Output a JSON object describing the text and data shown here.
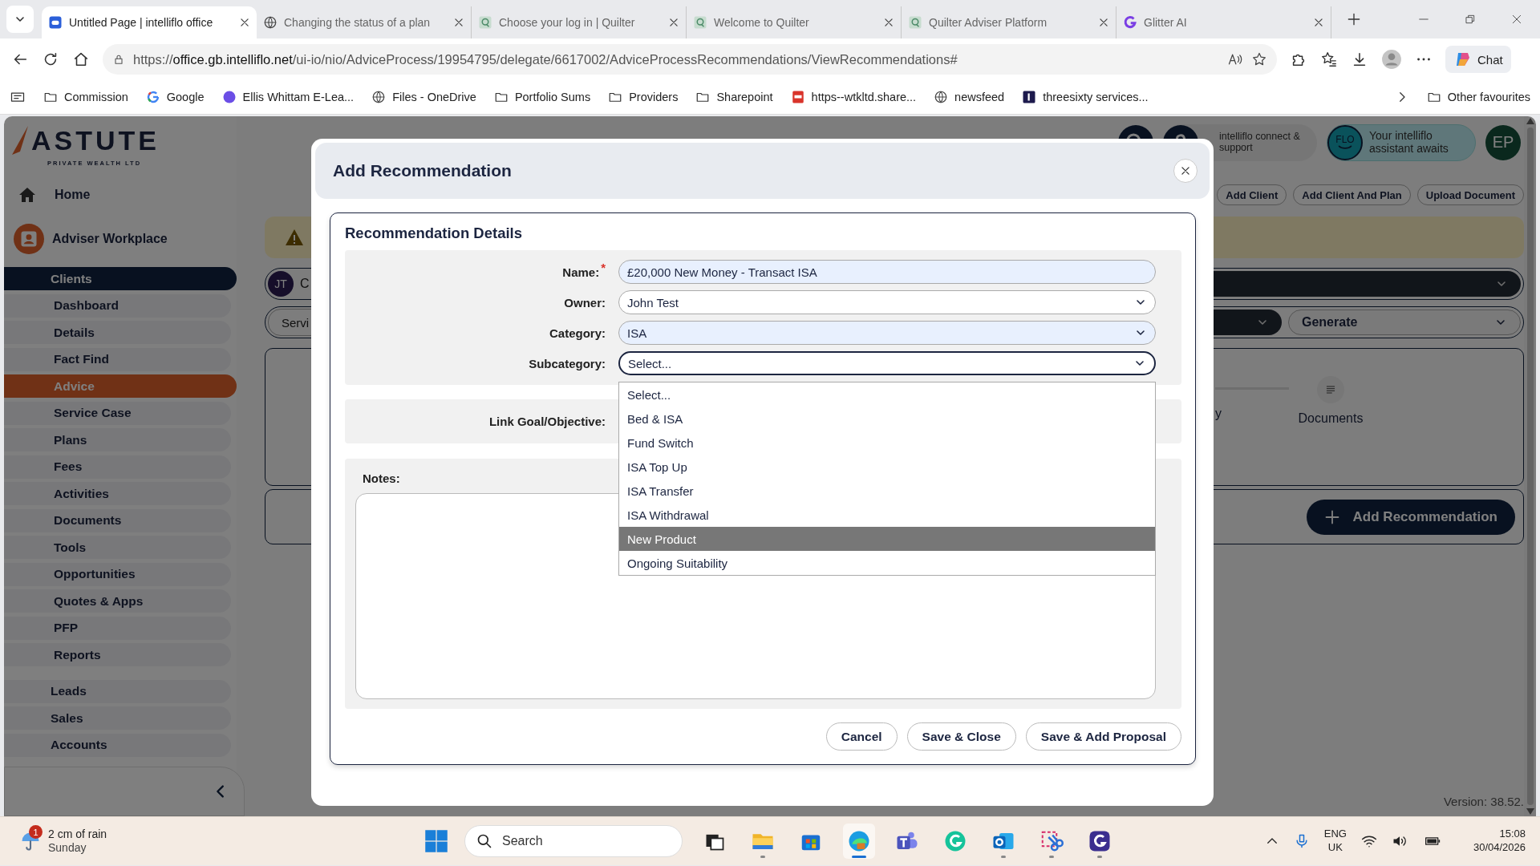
{
  "browser": {
    "tabs": [
      {
        "title": "Untitled Page | intelliflo office",
        "kind": "intelliflo",
        "selected": true
      },
      {
        "title": "Changing the status of a plan",
        "kind": "globe",
        "selected": false
      },
      {
        "title": "Choose your log in | Quilter",
        "kind": "quilter",
        "selected": false
      },
      {
        "title": "Welcome to Quilter",
        "kind": "quilter",
        "selected": false
      },
      {
        "title": "Quilter Adviser Platform",
        "kind": "quilter",
        "selected": false
      },
      {
        "title": "Glitter AI",
        "kind": "glitter",
        "selected": false
      }
    ],
    "url": "https://**office.gb.intelliflo.net**/ui-io/nio/AdviceProcess/19954795/delegate/6617002/AdviceProcessRecommendations/ViewRecommendations#",
    "chat": "Chat",
    "bookmarks": [
      {
        "label": "Commission",
        "kind": "folder"
      },
      {
        "label": "Google",
        "kind": "google"
      },
      {
        "label": "Ellis Whittam E-Lea...",
        "kind": "dot"
      },
      {
        "label": "Files - OneDrive",
        "kind": "globe"
      },
      {
        "label": "Portfolio Sums",
        "kind": "folder"
      },
      {
        "label": "Providers",
        "kind": "folder"
      },
      {
        "label": "Sharepoint",
        "kind": "folder"
      },
      {
        "label": "https--wtkltd.share...",
        "kind": "pdf"
      },
      {
        "label": "newsfeed",
        "kind": "globe"
      },
      {
        "label": "threesixty services...",
        "kind": "square"
      }
    ],
    "other_favourites": "Other favourites"
  },
  "sidebar": {
    "logo": {
      "name": "ASTUTE",
      "tagline": "PRIVATE WEALTH LTD"
    },
    "home": "Home",
    "workplace": "Adviser Workplace",
    "groups": [
      {
        "label": "Clients",
        "selected": true,
        "children": [
          {
            "label": "Dashboard",
            "selected": false
          },
          {
            "label": "Details",
            "selected": false
          },
          {
            "label": "Fact Find",
            "selected": false
          },
          {
            "label": "Advice",
            "selected": true
          },
          {
            "label": "Service Case",
            "selected": false
          },
          {
            "label": "Plans",
            "selected": false
          },
          {
            "label": "Fees",
            "selected": false
          },
          {
            "label": "Activities",
            "selected": false
          },
          {
            "label": "Documents",
            "selected": false
          },
          {
            "label": "Tools",
            "selected": false
          },
          {
            "label": "Opportunities",
            "selected": false
          },
          {
            "label": "Quotes & Apps",
            "selected": false
          },
          {
            "label": "PFP",
            "selected": false
          },
          {
            "label": "Reports",
            "selected": false
          }
        ]
      },
      {
        "label": "Leads",
        "selected": false
      },
      {
        "label": "Sales",
        "selected": false
      },
      {
        "label": "Accounts",
        "selected": false
      }
    ]
  },
  "header": {
    "support": "intelliflo connect & support",
    "flo": "FLO",
    "assistant": "Your intelliflo assistant awaits",
    "user_initials": "EP"
  },
  "actions": [
    "Add Client",
    "Add Client And Plan",
    "Upload Document"
  ],
  "client": {
    "initials": "JT",
    "name": "C"
  },
  "service_tab": "Servi",
  "generate": "Generate",
  "steps": [
    {
      "label": "y"
    },
    {
      "label": "Documents"
    }
  ],
  "add_recommendation": "Add Recommendation",
  "version": "Version: 38.52.",
  "modal": {
    "title": "Add Recommendation",
    "section": "Recommendation Details",
    "fields": [
      {
        "label": "Name:",
        "kind": "text",
        "value": "£20,000 New Money - Transact ISA",
        "required": true,
        "autofilled": true,
        "focused": false
      },
      {
        "label": "Owner:",
        "kind": "select",
        "value": "John Test",
        "required": false,
        "autofilled": false,
        "focused": false
      },
      {
        "label": "Category:",
        "kind": "select",
        "value": "ISA",
        "required": false,
        "autofilled": true,
        "focused": false
      },
      {
        "label": "Subcategory:",
        "kind": "select",
        "value": "Select...",
        "required": false,
        "autofilled": false,
        "focused": true
      }
    ],
    "required_mark": "*",
    "link_goal": "Link Goal/Objective:",
    "notes": "Notes:",
    "options": [
      {
        "label": "Select...",
        "selected": false
      },
      {
        "label": "Bed & ISA",
        "selected": false
      },
      {
        "label": "Fund Switch",
        "selected": false
      },
      {
        "label": "ISA Top Up",
        "selected": false
      },
      {
        "label": "ISA Transfer",
        "selected": false
      },
      {
        "label": "ISA Withdrawal",
        "selected": false
      },
      {
        "label": "New Product",
        "selected": true
      },
      {
        "label": "Ongoing Suitability",
        "selected": false
      }
    ],
    "buttons": [
      "Cancel",
      "Save & Close",
      "Save & Add Proposal"
    ]
  },
  "taskbar": {
    "weather": {
      "badge": "1",
      "text": "2 cm of rain",
      "day": "Sunday"
    },
    "search": "Search",
    "apps": [
      {
        "kind": "taskview",
        "running": false,
        "selected": false
      },
      {
        "kind": "explorer",
        "running": true,
        "selected": false
      },
      {
        "kind": "store",
        "running": false,
        "selected": false
      },
      {
        "kind": "edge",
        "running": true,
        "selected": true
      },
      {
        "kind": "teams",
        "running": false,
        "selected": false
      },
      {
        "kind": "grammarly",
        "running": false,
        "selected": false
      },
      {
        "kind": "outlook",
        "running": true,
        "selected": false
      },
      {
        "kind": "snip",
        "running": true,
        "selected": false
      },
      {
        "kind": "glitter",
        "running": true,
        "selected": false
      }
    ],
    "language": "ENG",
    "region": "UK",
    "time": "15:08",
    "date": "30/04/2026"
  }
}
